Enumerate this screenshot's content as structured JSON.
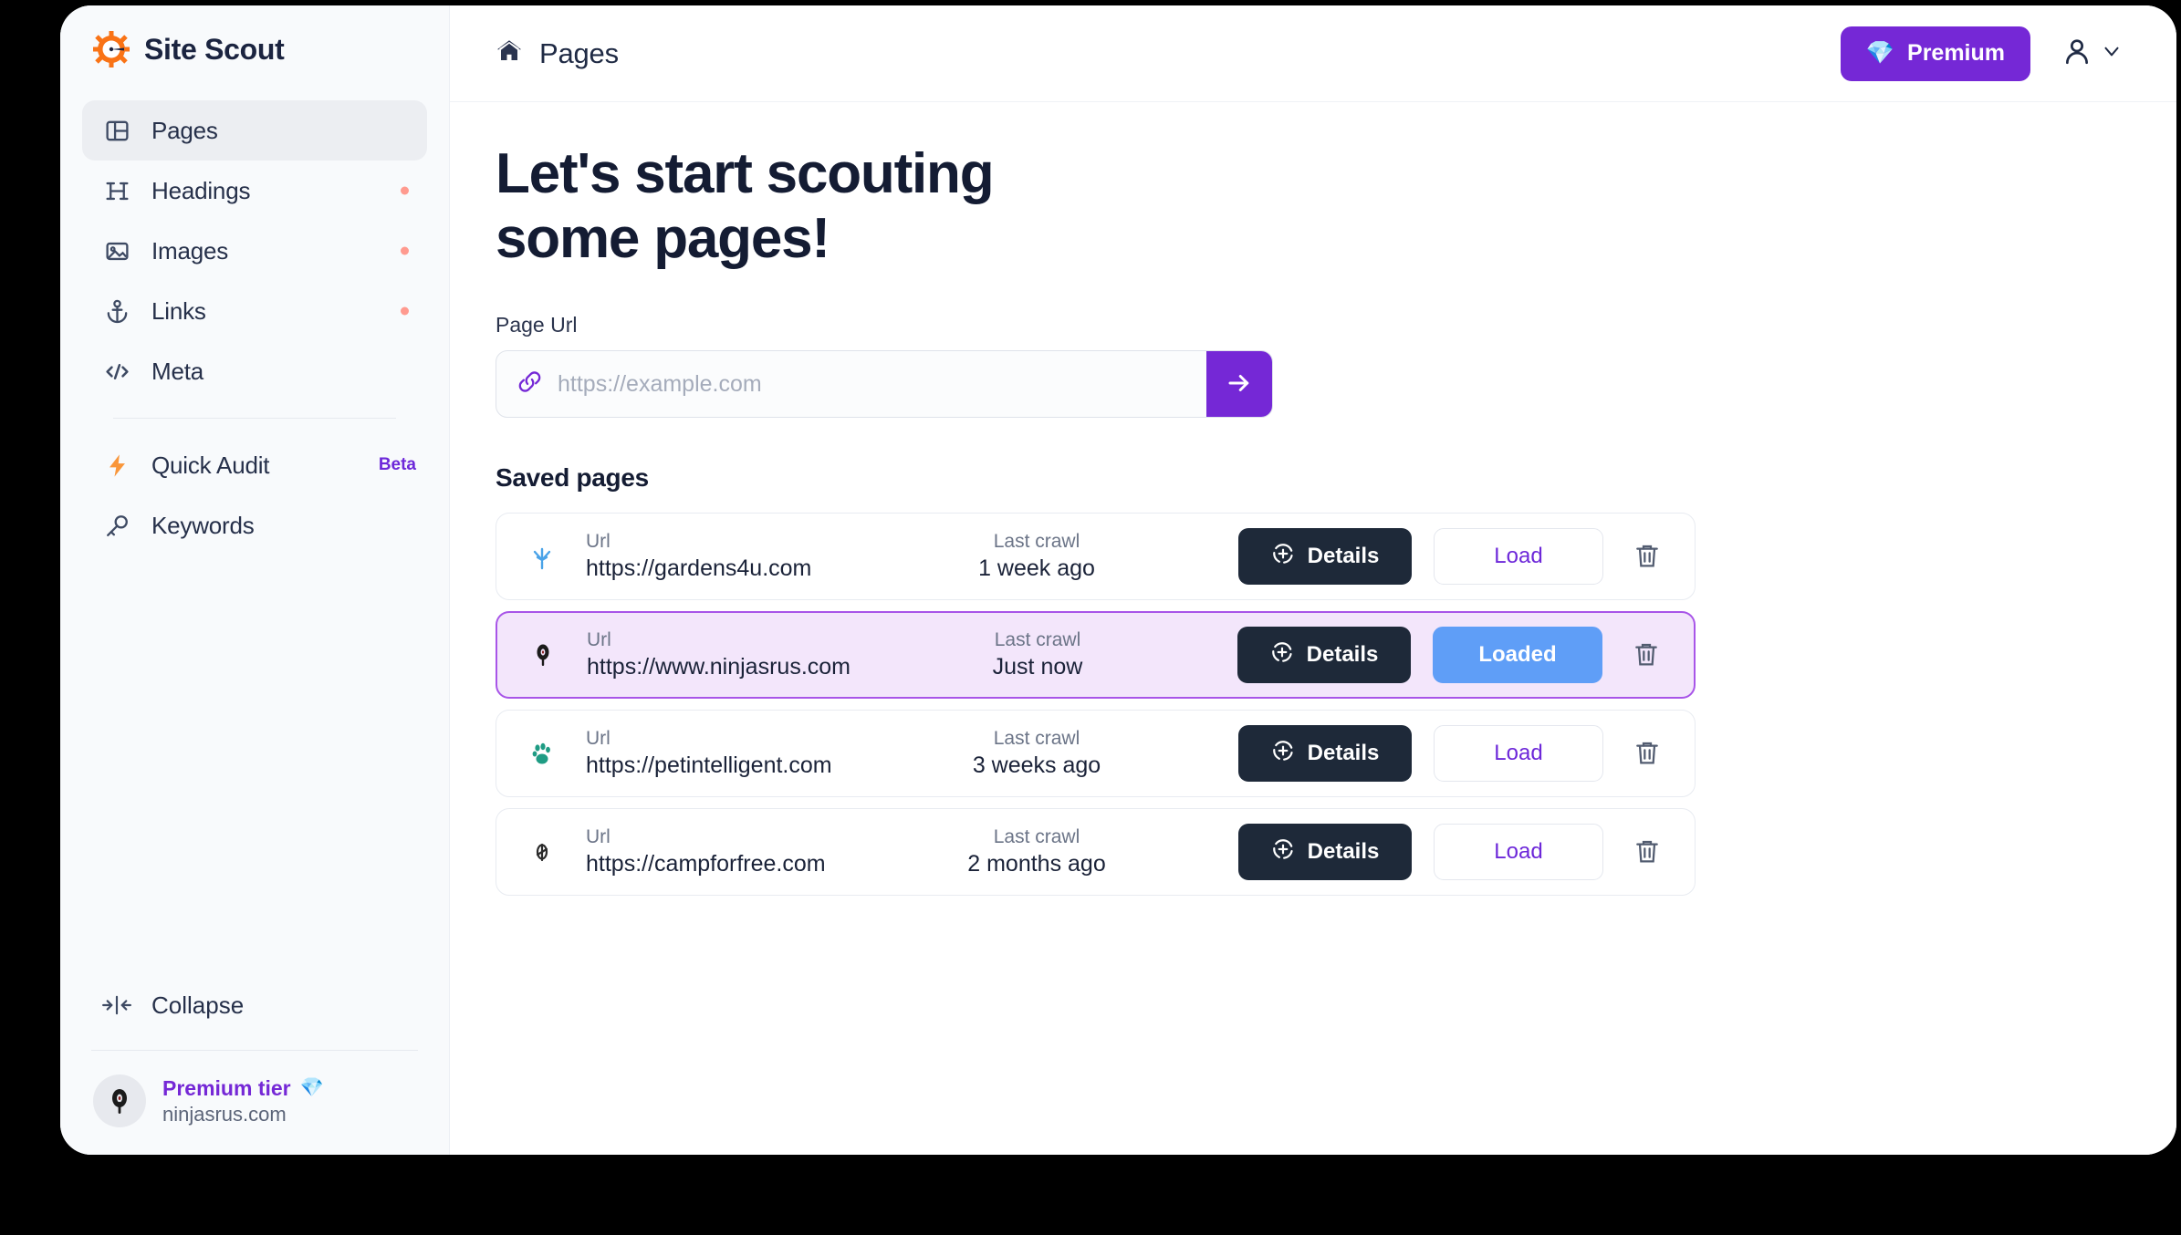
{
  "brand": {
    "name": "Site Scout",
    "logo_icon": "gear-compass-icon"
  },
  "sidebar": {
    "items": [
      {
        "label": "Pages",
        "icon": "layout-panel-icon",
        "active": true,
        "dot": false,
        "badge": null
      },
      {
        "label": "Headings",
        "icon": "heading-h-icon",
        "active": false,
        "dot": true,
        "badge": null
      },
      {
        "label": "Images",
        "icon": "image-icon",
        "active": false,
        "dot": true,
        "badge": null
      },
      {
        "label": "Links",
        "icon": "anchor-icon",
        "active": false,
        "dot": true,
        "badge": null
      },
      {
        "label": "Meta",
        "icon": "code-brackets-icon",
        "active": false,
        "dot": false,
        "badge": null
      }
    ],
    "tools": [
      {
        "label": "Quick Audit",
        "icon": "lightning-bolt-icon",
        "badge": "Beta"
      },
      {
        "label": "Keywords",
        "icon": "key-icon",
        "badge": null
      }
    ],
    "collapse": {
      "label": "Collapse",
      "icon": "collapse-arrows-icon"
    },
    "account": {
      "tier": "Premium tier",
      "tier_gem": "💎",
      "domain": "ninjasrus.com",
      "avatar_icon": "ninja-avatar-icon"
    }
  },
  "topbar": {
    "title": "Pages",
    "title_icon": "home-icon",
    "premium_label": "Premium",
    "premium_gem": "💎",
    "user_icon": "user-icon",
    "user_chevron_icon": "chevron-down-icon"
  },
  "main": {
    "hero_line1": "Let's start scouting",
    "hero_line2": "some pages!",
    "url_field": {
      "label": "Page Url",
      "placeholder": "https://example.com",
      "value": "",
      "icon": "link-chain-icon",
      "submit_icon": "arrow-right-icon"
    },
    "saved_title": "Saved pages",
    "column_labels": {
      "url": "Url",
      "crawl": "Last crawl"
    },
    "buttons": {
      "details": "Details",
      "details_icon": "target-plus-icon",
      "load": "Load",
      "loaded": "Loaded",
      "delete_icon": "trash-icon"
    },
    "rows": [
      {
        "favicon": "sprout-icon",
        "favicon_glyph": "🌱",
        "favicon_color": "#4aa3e8",
        "url": "https://gardens4u.com",
        "crawl": "1 week ago",
        "load_label": "Load",
        "loaded": false,
        "selected": false
      },
      {
        "favicon": "ninja-icon",
        "favicon_glyph": "☀",
        "favicon_color": "#1a1a1a",
        "url": "https://www.ninjasrus.com",
        "crawl": "Just now",
        "load_label": "Loaded",
        "loaded": true,
        "selected": true
      },
      {
        "favicon": "paw-icon",
        "favicon_glyph": "🐾",
        "favicon_color": "#1f9c84",
        "url": "https://petintelligent.com",
        "crawl": "3 weeks ago",
        "load_label": "Load",
        "loaded": false,
        "selected": false
      },
      {
        "favicon": "tent-icon",
        "favicon_glyph": "⛺",
        "favicon_color": "#2b2b2b",
        "url": "https://campforfree.com",
        "crawl": "2 months ago",
        "load_label": "Load",
        "loaded": false,
        "selected": false
      }
    ]
  },
  "colors": {
    "accent_purple": "#7528d6",
    "dark_navy": "#1e2939",
    "loaded_blue": "#5f9ef7",
    "selected_bg": "#f3e6fb",
    "selected_border": "#a855e8",
    "brand_orange": "#f97316",
    "dot_red": "#ff9a8f"
  }
}
